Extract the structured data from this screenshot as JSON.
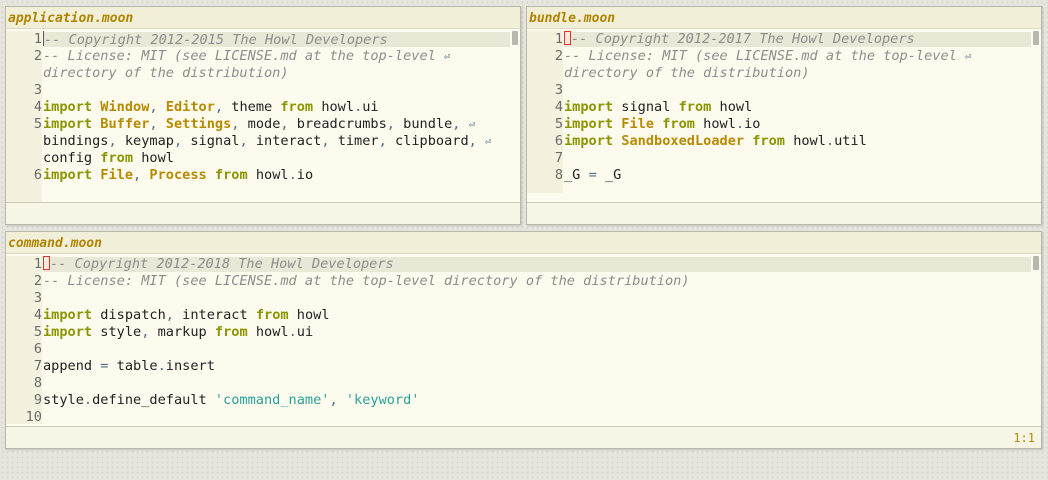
{
  "panes": {
    "application": {
      "title": "application.moon",
      "lines": [
        {
          "n": "1",
          "t": "-- Copyright 2012-2015 The Howl Developers"
        },
        {
          "n": "2",
          "t": "-- License: MIT (see LICENSE.md at the top-level"
        },
        {
          "n": "",
          "t": "directory of the distribution)"
        },
        {
          "n": "3",
          "t": ""
        },
        {
          "n": "4",
          "t": "import Window, Editor, theme from howl.ui"
        },
        {
          "n": "5",
          "t": "import Buffer, Settings, mode, breadcrumbs, bundle,"
        },
        {
          "n": "",
          "t": "bindings, keymap, signal, interact, timer, clipboard,"
        },
        {
          "n": "",
          "t": "config from howl"
        },
        {
          "n": "6",
          "t": "import File, Process from howl.io"
        }
      ]
    },
    "bundle": {
      "title": "bundle.moon",
      "lines": [
        {
          "n": "1",
          "t": "-- Copyright 2012-2017 The Howl Developers"
        },
        {
          "n": "2",
          "t": "-- License: MIT (see LICENSE.md at the top-level"
        },
        {
          "n": "",
          "t": "directory of the distribution)"
        },
        {
          "n": "3",
          "t": ""
        },
        {
          "n": "4",
          "t": "import signal from howl"
        },
        {
          "n": "5",
          "t": "import File from howl.io"
        },
        {
          "n": "6",
          "t": "import SandboxedLoader from howl.util"
        },
        {
          "n": "7",
          "t": ""
        },
        {
          "n": "8",
          "t": "_G = _G"
        }
      ]
    },
    "command": {
      "title": "command.moon",
      "lines": [
        {
          "n": "1",
          "t": "-- Copyright 2012-2018 The Howl Developers"
        },
        {
          "n": "2",
          "t": "-- License: MIT (see LICENSE.md at the top-level directory of the distribution)"
        },
        {
          "n": "3",
          "t": ""
        },
        {
          "n": "4",
          "t": "import dispatch, interact from howl"
        },
        {
          "n": "5",
          "t": "import style, markup from howl.ui"
        },
        {
          "n": "6",
          "t": ""
        },
        {
          "n": "7",
          "t": "append = table.insert"
        },
        {
          "n": "8",
          "t": ""
        },
        {
          "n": "9",
          "t": "style.define_default 'command_name', 'keyword'"
        },
        {
          "n": "10",
          "t": ""
        }
      ],
      "cursor_position": "1:1"
    }
  },
  "colors": {
    "title": "#b18400",
    "keyword": "#8b9500",
    "class": "#b78a00",
    "string": "#2aa198",
    "comment": "#8d8d8d",
    "background": "#fdfbee"
  }
}
